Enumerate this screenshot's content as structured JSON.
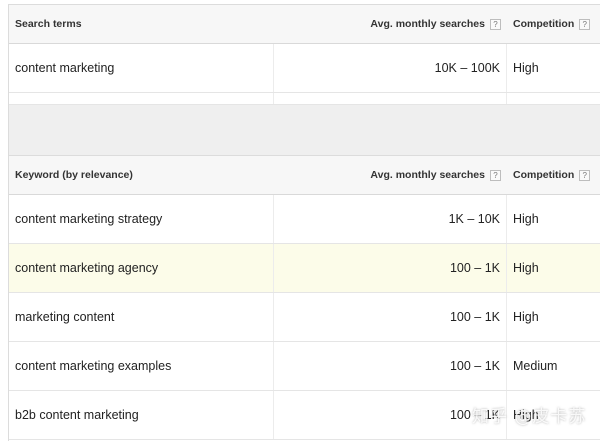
{
  "search_panel": {
    "headers": {
      "term": "Search terms",
      "avg": "Avg. monthly searches",
      "competition": "Competition",
      "help": "?"
    },
    "rows": [
      {
        "term": "content marketing",
        "avg": "10K – 100K",
        "competition": "High"
      }
    ]
  },
  "keyword_panel": {
    "headers": {
      "term": "Keyword (by relevance)",
      "avg": "Avg. monthly searches",
      "competition": "Competition",
      "help": "?"
    },
    "rows": [
      {
        "term": "content marketing strategy",
        "avg": "1K – 10K",
        "competition": "High"
      },
      {
        "term": "content marketing agency",
        "avg": "100 – 1K",
        "competition": "High",
        "highlighted": true
      },
      {
        "term": "marketing content",
        "avg": "100 – 1K",
        "competition": "High"
      },
      {
        "term": "content marketing examples",
        "avg": "100 – 1K",
        "competition": "Medium"
      },
      {
        "term": "b2b content marketing",
        "avg": "100 – 1K",
        "competition": "High"
      }
    ]
  },
  "watermark": "知乎 @皮卡苏",
  "colors": {
    "highlight_row": "#fcfce9",
    "header_bg": "#f7f7f7",
    "gap_bg": "#efefef"
  }
}
